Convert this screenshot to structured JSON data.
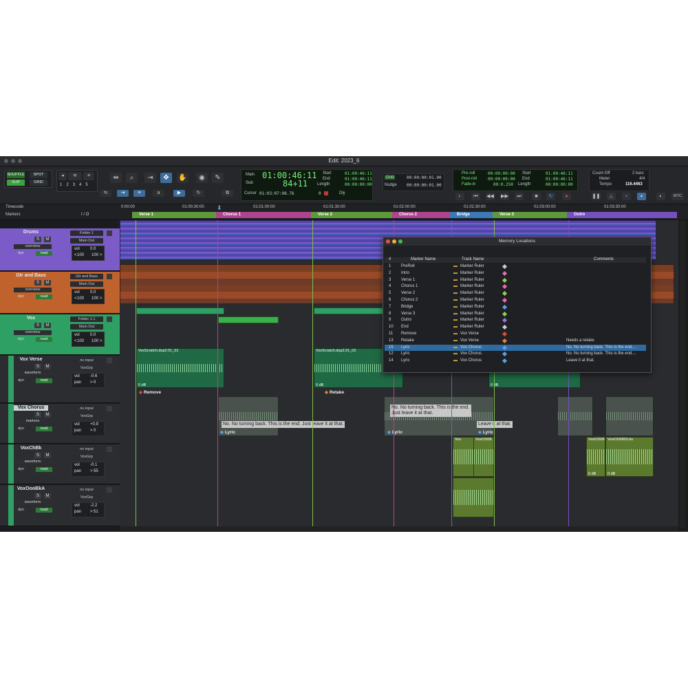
{
  "window": {
    "title": "Edit: 2023_6"
  },
  "toolbar": {
    "modes": {
      "shuffle": "SHUFFLE",
      "spot": "SPOT",
      "slip": "SLIP",
      "grid": "GRID"
    },
    "zoom_presets": [
      "1",
      "2",
      "3",
      "4",
      "5"
    ],
    "counter": {
      "main_label": "Main",
      "sub_label": "Sub",
      "main_value": "01:00:46:11",
      "sub_value": "84+11",
      "start_label": "Start",
      "end_label": "End",
      "length_label": "Length",
      "start_value": "01:00:46:11",
      "end_value": "01:00:46:11",
      "length_value": "00:00:00:00",
      "cursor_label": "Cursor",
      "cursor_value": "01:03:07:08.76",
      "dly_label": "Dly",
      "dly_value": "0"
    },
    "grid": {
      "grid_label": "Grid",
      "grid_value": "00:00:00:01.00",
      "nudge_label": "Nudge",
      "nudge_value": "00:00:00:01.00"
    },
    "transport": {
      "preroll_label": "Pre-roll",
      "postroll_label": "Post-roll",
      "fadein_label": "Fade-in",
      "preroll_value": "00:00:00:00",
      "postroll_value": "00:00:00:00",
      "fadein_value": "00:0.250",
      "start_label": "Start",
      "end_label": "End",
      "length_label": "Length",
      "start_value": "01:00:46:11",
      "end_value": "01:00:46:11",
      "length_value": "00:00:00:00"
    },
    "tempo": {
      "countoff_label": "Count Off",
      "countoff_value": "2 bars",
      "meter_label": "Meter",
      "meter_value": "4/4",
      "tempo_label": "Tempo",
      "tempo_value": "116.4463"
    },
    "mtc": "MTC"
  },
  "rulers": {
    "timecode_label": "Timecode",
    "markers_label": "Markers",
    "ticks": [
      "0:00:00",
      "01:00:30:00",
      "01:01:00:00",
      "01:01:30:00",
      "01:02:00:00",
      "01:02:30:00",
      "01:03:00:00",
      "01:03:30:00"
    ],
    "markers": [
      {
        "name": "Verse 1",
        "color": "#5f9a3a"
      },
      {
        "name": "Chorus 1",
        "color": "#b0438f"
      },
      {
        "name": "Verse 2",
        "color": "#5f9a3a"
      },
      {
        "name": "Chorus 2",
        "color": "#b0438f"
      },
      {
        "name": "Bridge",
        "color": "#3a7ab8"
      },
      {
        "name": "Verse 3",
        "color": "#5f9a3a"
      },
      {
        "name": "Outro",
        "color": "#7750c0"
      }
    ],
    "io_label": "I / O"
  },
  "tracks": [
    {
      "name": "Drums",
      "color": "#7b5bc8",
      "io1": "Folder 1",
      "io2": "Main Out",
      "view": "overview",
      "vol": "0.0",
      "pan": "100",
      "pan2": "100",
      "auto": "read",
      "dyn": "dyn"
    },
    {
      "name": "Gtr and Bass",
      "color": "#c0622b",
      "io1": "Gtr and Bass",
      "io2": "Main Out",
      "view": "overview",
      "vol": "0.0",
      "pan": "100",
      "pan2": "100",
      "auto": "read",
      "dyn": "dyn"
    },
    {
      "name": "Vox",
      "color": "#2fa064",
      "io1": "Folder 1.1",
      "io2": "Main Out",
      "view": "overview",
      "vol": "0.0",
      "pan": "100",
      "pan2": "100",
      "auto": "read",
      "dyn": "dyn"
    },
    {
      "name": "Vox Verse",
      "color": "#2fa064",
      "io1": "no input",
      "io2": "VoxGrp",
      "view": "waveform",
      "vol": "-0.6",
      "pan": "0",
      "auto": "read",
      "dyn": "dyn"
    },
    {
      "name": "Vox Chorus",
      "color": "#2fa064",
      "io1": "no input",
      "io2": "VoxGrp",
      "view": "markers",
      "vol": "+0.9",
      "pan": "0",
      "auto": "read",
      "dyn": "dyn"
    },
    {
      "name": "VoxChBk",
      "color": "#2fa064",
      "io1": "no input",
      "io2": "VoxGrp",
      "view": "waveform",
      "vol": "-0.1",
      "pan": "55",
      "auto": "read",
      "dyn": "dyn"
    },
    {
      "name": "VoxOooBkA",
      "color": "#2fa064",
      "io1": "no input",
      "io2": "VoxGrp",
      "view": "waveform",
      "vol": "-2.2",
      "pan": "51",
      "auto": "read",
      "dyn": "dyn"
    }
  ],
  "clips": {
    "vox_verse_1": "VoxScratch.dup2.01_01",
    "vox_verse_2": "VoxScratch.dup2.01_02",
    "db": "0 dB",
    "voxchbk_1": "Vox",
    "voxchbk_2": "VoxOD08",
    "voxchbk_3": "VoxOD08",
    "voxchbk_4": "VoxOD0803.du"
  },
  "memory_markers": {
    "remove": "Remove",
    "retake": "Retake",
    "lyric": "Lyric",
    "lyric_text_1": "No. No turning back. This is the end. Just leave it at that.",
    "lyric_text_2": "No. No turning back. This is the end. Just leave it at that.",
    "lyric_text_3": "Leave it at that."
  },
  "memory_locations": {
    "title": "Memory Locations",
    "headers": {
      "num": "#",
      "name": "Marker Name",
      "track": "Track Name",
      "comments": "Comments"
    },
    "rows": [
      {
        "num": "1",
        "name": "PreRoll",
        "track": "Marker Ruler",
        "color": "#cccccc",
        "comment": ""
      },
      {
        "num": "2",
        "name": "Intro",
        "track": "Marker Ruler",
        "color": "#e86bb0",
        "comment": ""
      },
      {
        "num": "3",
        "name": "Verse 1",
        "track": "Marker Ruler",
        "color": "#8fd14f",
        "comment": ""
      },
      {
        "num": "4",
        "name": "Chorus 1",
        "track": "Marker Ruler",
        "color": "#e86bb0",
        "comment": ""
      },
      {
        "num": "5",
        "name": "Verse 2",
        "track": "Marker Ruler",
        "color": "#8fd14f",
        "comment": ""
      },
      {
        "num": "6",
        "name": "Chorus 2",
        "track": "Marker Ruler",
        "color": "#e86bb0",
        "comment": ""
      },
      {
        "num": "7",
        "name": "Bridge",
        "track": "Marker Ruler",
        "color": "#5aa0e6",
        "comment": ""
      },
      {
        "num": "8",
        "name": "Verse 3",
        "track": "Marker Ruler",
        "color": "#8fd14f",
        "comment": ""
      },
      {
        "num": "9",
        "name": "Outro",
        "track": "Marker Ruler",
        "color": "#9b6fe0",
        "comment": ""
      },
      {
        "num": "10",
        "name": "End",
        "track": "Marker Ruler",
        "color": "#cccccc",
        "comment": ""
      },
      {
        "num": "11",
        "name": "Remove",
        "track": "Vox Verse",
        "color": "#e04a3a",
        "comment": ""
      },
      {
        "num": "13",
        "name": "Retake",
        "track": "Vox Verse",
        "color": "#e07f3a",
        "comment": "Needs a retake"
      },
      {
        "num": "15",
        "name": "Lyric",
        "track": "Vox Chorus",
        "color": "#5aa0e6",
        "comment": "No. No turning back. This is the end....",
        "selected": true
      },
      {
        "num": "12",
        "name": "Lyric",
        "track": "Vox Chorus",
        "color": "#5aa0e6",
        "comment": "No. No turning back. This is the end...."
      },
      {
        "num": "14",
        "name": "Lyric",
        "track": "Vox Chorus",
        "color": "#5aa0e6",
        "comment": "Leave it at that."
      }
    ]
  }
}
